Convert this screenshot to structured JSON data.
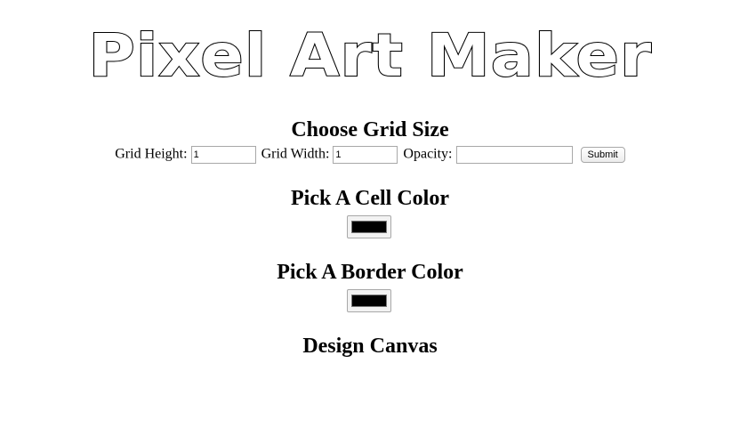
{
  "header": {
    "title": "Pixel Art Maker"
  },
  "grid_section": {
    "heading": "Choose Grid Size",
    "height_label": "Grid Height:",
    "height_value": "1",
    "width_label": "Grid Width:",
    "width_value": "1",
    "opacity_label": "Opacity:",
    "opacity_value": "",
    "submit_label": "Submit"
  },
  "cell_color_section": {
    "heading": "Pick A Cell Color",
    "color": "#000000"
  },
  "border_color_section": {
    "heading": "Pick A Border Color",
    "color": "#000000"
  },
  "canvas_section": {
    "heading": "Design Canvas"
  }
}
